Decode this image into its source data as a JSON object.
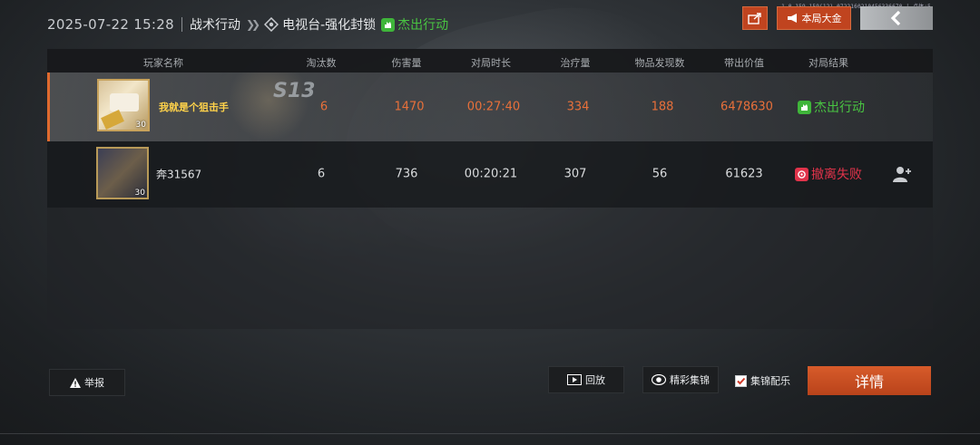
{
  "header": {
    "timestamp": "2025-07-22 15:28",
    "mode": "战术行动",
    "map": "电视台-强化封锁",
    "status": "杰出行动",
    "meta_code": "1.0.159.159(12).0722160210456336670 | 点体:5"
  },
  "top_buttons": {
    "mvp_label": "本局大金"
  },
  "table": {
    "columns": [
      "玩家名称",
      "淘汰数",
      "伤害量",
      "对局时长",
      "治疗量",
      "物品发现数",
      "带出价值",
      "对局结果"
    ],
    "rows": [
      {
        "name": "我就是个狙击手",
        "level": "30",
        "badge_text": "S13",
        "eliminations": "6",
        "damage": "1470",
        "duration": "00:27:40",
        "healing": "334",
        "items_found": "188",
        "extracted_value": "6478630",
        "result": "杰出行动"
      },
      {
        "name": "奔31567",
        "level": "30",
        "eliminations": "6",
        "damage": "736",
        "duration": "00:20:21",
        "healing": "307",
        "items_found": "56",
        "extracted_value": "61623",
        "result": "撤离失败"
      }
    ]
  },
  "bottom": {
    "report_label": "举报",
    "replay_label": "回放",
    "highlights_label": "精彩集锦",
    "music_label": "集锦配乐",
    "music_checked": true,
    "detail_label": "详情"
  },
  "colors": {
    "accent_orange": "#c0441f",
    "success_green": "#49c442",
    "fail_red": "#e0334a",
    "self_highlight": "#e8703a"
  }
}
